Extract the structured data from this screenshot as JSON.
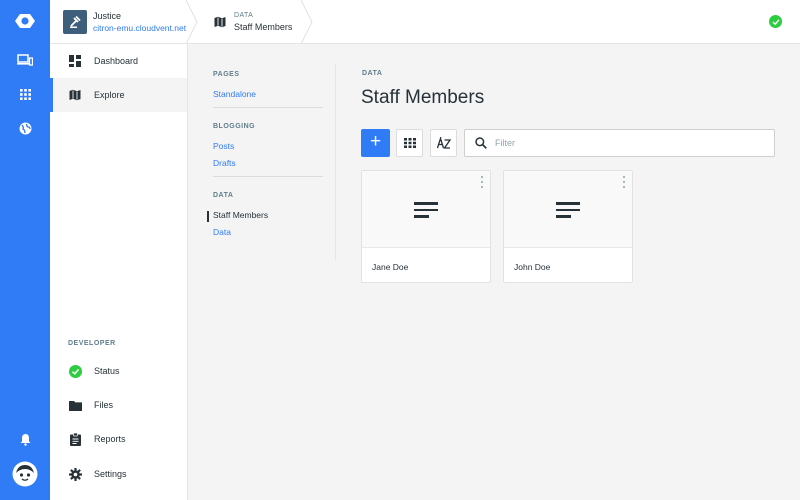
{
  "app": {
    "title": "Staff Members",
    "colors": {
      "accent": "#2f7cf6",
      "success": "#2ecc40",
      "text": "#263238",
      "muted": "#607d8b"
    }
  },
  "rail": {
    "icons": [
      "logo-icon",
      "devices-icon",
      "apps-grid-icon",
      "globe-icon",
      "notifications-bell-icon",
      "user-avatar-icon"
    ]
  },
  "project": {
    "name": "Justice",
    "url": "citron-emu.cloudvent.net"
  },
  "breadcrumb": {
    "group": "DATA",
    "title": "Staff Members",
    "icon": "map-icon"
  },
  "topbar": {
    "status": "success",
    "status_icon": "check-circle-icon"
  },
  "nav": {
    "items": [
      {
        "label": "Dashboard",
        "icon": "dashboard-icon",
        "active": false
      },
      {
        "label": "Explore",
        "icon": "map-icon",
        "active": true
      }
    ],
    "developer_heading": "DEVELOPER",
    "developer_items": [
      {
        "label": "Status",
        "icon": "check-circle-icon"
      },
      {
        "label": "Files",
        "icon": "folder-icon"
      },
      {
        "label": "Reports",
        "icon": "clipboard-icon"
      },
      {
        "label": "Settings",
        "icon": "gear-icon"
      }
    ]
  },
  "collections": {
    "sections": [
      {
        "heading": "PAGES",
        "links": [
          {
            "label": "Standalone",
            "active": false
          }
        ]
      },
      {
        "heading": "BLOGGING",
        "links": [
          {
            "label": "Posts",
            "active": false
          },
          {
            "label": "Drafts",
            "active": false
          }
        ]
      },
      {
        "heading": "DATA",
        "links": [
          {
            "label": "Staff Members",
            "active": true
          },
          {
            "label": "Data",
            "active": false
          }
        ]
      }
    ]
  },
  "main": {
    "group_label": "DATA",
    "title": "Staff Members",
    "add_label": "+",
    "filter_placeholder": "Filter",
    "filter_value": "",
    "toolbar_icons": [
      "grid-view-icon",
      "sort-az-icon"
    ],
    "cards": [
      {
        "name": "Jane Doe",
        "icon": "text-lines-icon"
      },
      {
        "name": "John Doe",
        "icon": "text-lines-icon"
      }
    ]
  }
}
